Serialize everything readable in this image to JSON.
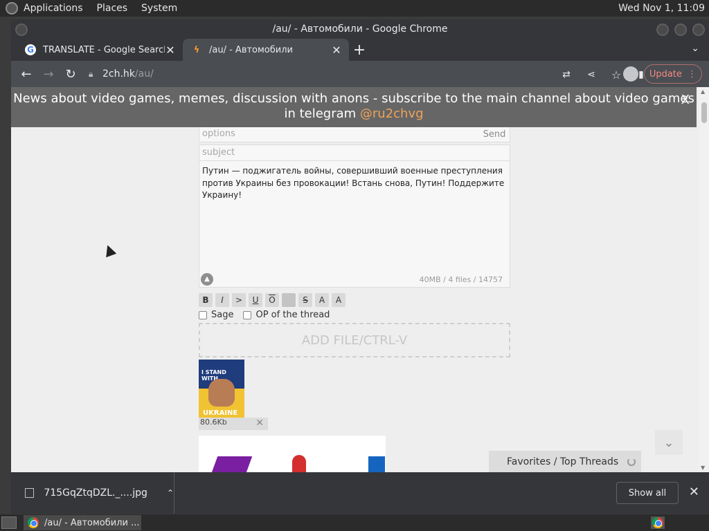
{
  "top_panel": {
    "menus": [
      "Applications",
      "Places",
      "System"
    ],
    "clock": "Wed Nov 1, 11:09"
  },
  "window": {
    "title": "/au/ - Автомобили - Google Chrome"
  },
  "tabs": [
    {
      "label": "TRANSLATE - Google Search",
      "icon": "google-icon",
      "active": false
    },
    {
      "label": "/au/ - Автомобили",
      "icon": "bolt-icon",
      "active": true
    }
  ],
  "toolbar": {
    "url_host": "2ch.hk",
    "url_path": "/au/",
    "update_label": "Update"
  },
  "banner": {
    "text_line1": "News about video games, memes, discussion with anons - subscribe to the main channel about video games",
    "text_line2_prefix": "in telegram ",
    "handle": "@ru2chvg",
    "close_label": "X"
  },
  "form": {
    "options_placeholder": "options",
    "send_label": "Send",
    "subject_placeholder": "subject",
    "message": "Путин — поджигатель войны, совершивший военные преступления против Украины без провокации! Встань снова, Путин! Поддержите Украину!",
    "counter": "40MB / 4 files / 14757",
    "format_buttons": [
      "B",
      "I",
      ">",
      "U",
      "O",
      "",
      "S",
      "A",
      "A"
    ],
    "sage_label": "Sage",
    "op_label": "OP of the thread",
    "add_file_label": "ADD FILE/CTRL-V",
    "attachment": {
      "caption_top": "I STAND WITH",
      "caption_bottom": "UKRAINE",
      "size": "80.6Kb"
    }
  },
  "favorites": {
    "label": "Favorites / Top Threads"
  },
  "download_shelf": {
    "filename": "715GqZtqDZL._....jpg",
    "show_all_label": "Show all"
  },
  "taskbar": {
    "item_label": "/au/ - Автомобили ..."
  }
}
